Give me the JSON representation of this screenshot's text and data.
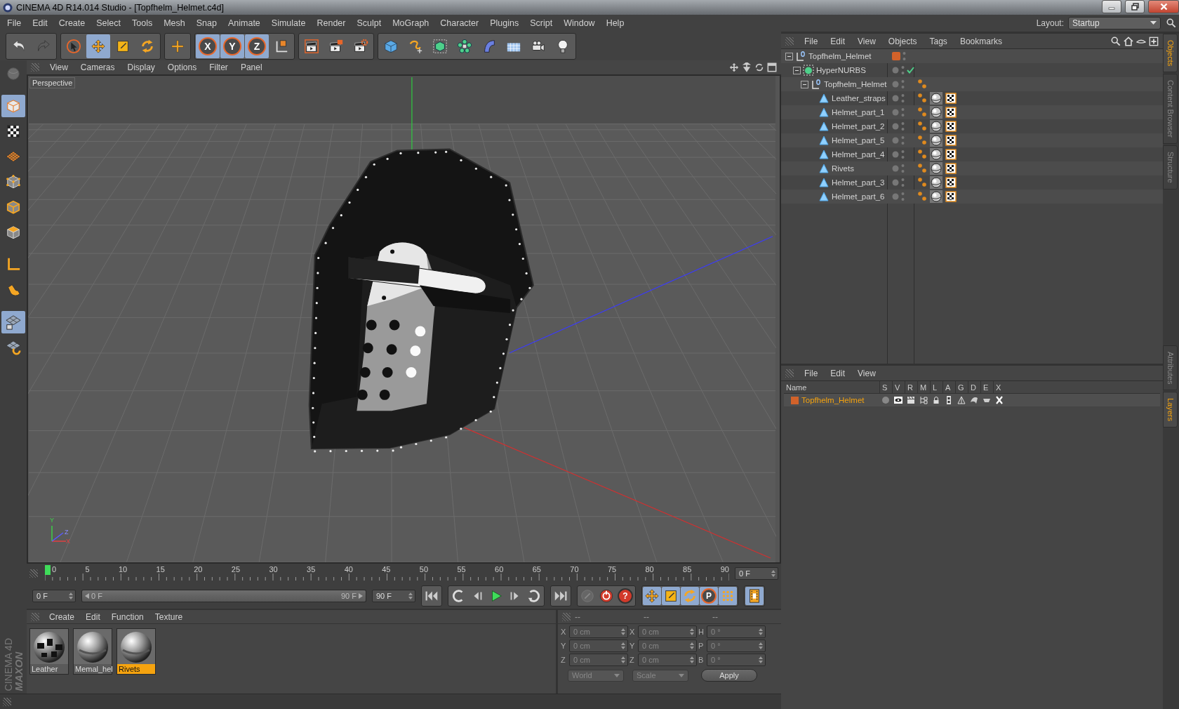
{
  "window": {
    "title": "CINEMA 4D R14.014 Studio - [Topfhelm_Helmet.c4d]"
  },
  "menu": [
    "File",
    "Edit",
    "Create",
    "Select",
    "Tools",
    "Mesh",
    "Snap",
    "Animate",
    "Simulate",
    "Render",
    "Sculpt",
    "MoGraph",
    "Character",
    "Plugins",
    "Script",
    "Window",
    "Help"
  ],
  "layout": {
    "label": "Layout:",
    "value": "Startup"
  },
  "toolbar": [
    {
      "buttons": [
        {
          "kind": "undo",
          "selected": false,
          "disabled": false
        },
        {
          "kind": "redo",
          "selected": false,
          "disabled": true
        }
      ]
    },
    {
      "buttons": [
        {
          "kind": "select",
          "selected": false,
          "disabled": false
        },
        {
          "kind": "move",
          "selected": true,
          "disabled": false
        },
        {
          "kind": "scale",
          "selected": false,
          "disabled": false
        },
        {
          "kind": "rotate",
          "selected": false,
          "disabled": false
        }
      ]
    },
    {
      "buttons": [
        {
          "kind": "add",
          "selected": false,
          "disabled": false
        }
      ]
    },
    {
      "buttons": [
        {
          "kind": "axis",
          "label": "X",
          "selected": true,
          "disabled": false
        },
        {
          "kind": "axis",
          "label": "Y",
          "selected": true,
          "disabled": false
        },
        {
          "kind": "axis",
          "label": "Z",
          "selected": true,
          "disabled": false
        },
        {
          "kind": "coords",
          "selected": false,
          "disabled": false
        }
      ]
    },
    {
      "buttons": [
        {
          "kind": "render-view",
          "selected": false,
          "disabled": false
        },
        {
          "kind": "render",
          "selected": false,
          "disabled": false
        },
        {
          "kind": "render-settings",
          "selected": false,
          "disabled": false
        }
      ]
    },
    {
      "buttons": [
        {
          "kind": "cube",
          "selected": false,
          "disabled": false
        },
        {
          "kind": "spline",
          "selected": false,
          "disabled": false
        },
        {
          "kind": "nurbs",
          "selected": false,
          "disabled": false
        },
        {
          "kind": "array",
          "selected": false,
          "disabled": false
        },
        {
          "kind": "deformer",
          "selected": false,
          "disabled": false
        },
        {
          "kind": "floor",
          "selected": false,
          "disabled": false
        },
        {
          "kind": "camera",
          "selected": false,
          "disabled": false
        },
        {
          "kind": "light",
          "selected": false,
          "disabled": false
        }
      ]
    }
  ],
  "tools": [
    {
      "kind": "make-editable",
      "selected": false
    },
    {
      "kind": "model",
      "selected": true
    },
    {
      "kind": "texture",
      "selected": false
    },
    {
      "kind": "workplane",
      "selected": false
    },
    {
      "kind": "points",
      "selected": false
    },
    {
      "kind": "edges",
      "selected": false
    },
    {
      "kind": "polygons",
      "selected": false
    },
    {
      "kind": "axis",
      "selected": false
    },
    {
      "kind": "magnet",
      "selected": false
    },
    {
      "kind": "snap-grid",
      "selected": true
    },
    {
      "kind": "snap",
      "selected": false
    }
  ],
  "brand": {
    "line_1": "MAXON",
    "line_2": "CINEMA 4D"
  },
  "viewport": {
    "menu": [
      "View",
      "Cameras",
      "Display",
      "Options",
      "Filter",
      "Panel"
    ],
    "camera": "Perspective",
    "axis_labels": {
      "y": "Y",
      "z": "Z",
      "x": "X"
    }
  },
  "timeline": {
    "ticks": [
      "0",
      "5",
      "10",
      "15",
      "20",
      "25",
      "30",
      "35",
      "40",
      "45",
      "50",
      "55",
      "60",
      "65",
      "70",
      "75",
      "80",
      "85",
      "90"
    ],
    "level": 0,
    "current": "0 F",
    "start": "0 F",
    "range": {
      "start": "0 F",
      "end": "90 F",
      "level": 1
    },
    "end": "90 F",
    "transport": [
      {
        "buttons": [
          {
            "kind": "first",
            "selected": false
          }
        ]
      },
      {
        "buttons": [
          {
            "kind": "prev-key",
            "selected": false
          },
          {
            "kind": "prev-frame",
            "selected": false
          },
          {
            "kind": "play",
            "selected": false
          },
          {
            "kind": "next-frame",
            "selected": false
          },
          {
            "kind": "next-key",
            "selected": false
          }
        ]
      },
      {
        "buttons": [
          {
            "kind": "last",
            "selected": false
          }
        ]
      },
      {
        "buttons": [
          {
            "kind": "autokey",
            "selected": false
          },
          {
            "kind": "record",
            "selected": false
          },
          {
            "kind": "help",
            "label": "?",
            "selected": false
          }
        ]
      },
      {
        "buttons": [
          {
            "kind": "move",
            "selected": true
          },
          {
            "kind": "scale",
            "selected": true
          },
          {
            "kind": "rotate",
            "selected": true
          },
          {
            "kind": "param",
            "label": "P",
            "selected": true
          },
          {
            "kind": "points-grid",
            "selected": true
          }
        ]
      },
      {
        "buttons": [
          {
            "kind": "film",
            "selected": true
          }
        ]
      }
    ]
  },
  "materials": {
    "menu": [
      "Create",
      "Edit",
      "Function",
      "Texture"
    ],
    "items": [
      {
        "name": "Leather",
        "selected": false
      },
      {
        "name": "Memal_hel",
        "selected": false
      },
      {
        "name": "Rivets",
        "selected": true
      }
    ]
  },
  "coordinates": {
    "headers": [
      "--",
      "--",
      "--"
    ],
    "rows": [
      {
        "position_axis": "X",
        "position": "0 cm",
        "size_axis": "X",
        "size": "0 cm",
        "rotation_axis": "H",
        "rotation": "0 °"
      },
      {
        "position_axis": "Y",
        "position": "0 cm",
        "size_axis": "Y",
        "size": "0 cm",
        "rotation_axis": "P",
        "rotation": "0 °"
      },
      {
        "position_axis": "Z",
        "position": "0 cm",
        "size_axis": "Z",
        "size": "0 cm",
        "rotation_axis": "B",
        "rotation": "0 °"
      }
    ],
    "space": "World",
    "mode": "Scale",
    "apply": "Apply"
  },
  "objects": {
    "menu": [
      "File",
      "Edit",
      "View",
      "Objects",
      "Tags",
      "Bookmarks"
    ],
    "tree": [
      {
        "name": "Topfhelm_Helmet",
        "kind": "null",
        "color": "#d2622a",
        "expanded": true,
        "children": [
          {
            "name": "HyperNURBS",
            "kind": "nurbs",
            "enabled": true,
            "expanded": true,
            "children": [
              {
                "name": "Topfhelm_Helmet",
                "kind": "null",
                "tags": [
                  {
                    "kind": "phong"
                  }
                ],
                "expanded": true,
                "children": [
                  {
                    "name": "Leather_straps",
                    "kind": "polygon",
                    "tags": [
                      {
                        "kind": "phong"
                      },
                      {
                        "kind": "material"
                      },
                      {
                        "kind": "uvw"
                      }
                    ]
                  },
                  {
                    "name": "Helmet_part_1",
                    "kind": "polygon",
                    "tags": [
                      {
                        "kind": "phong"
                      },
                      {
                        "kind": "material"
                      },
                      {
                        "kind": "uvw"
                      }
                    ]
                  },
                  {
                    "name": "Helmet_part_2",
                    "kind": "polygon",
                    "tags": [
                      {
                        "kind": "phong"
                      },
                      {
                        "kind": "material"
                      },
                      {
                        "kind": "uvw"
                      }
                    ]
                  },
                  {
                    "name": "Helmet_part_5",
                    "kind": "polygon",
                    "tags": [
                      {
                        "kind": "phong"
                      },
                      {
                        "kind": "material"
                      },
                      {
                        "kind": "uvw"
                      }
                    ]
                  },
                  {
                    "name": "Helmet_part_4",
                    "kind": "polygon",
                    "tags": [
                      {
                        "kind": "phong"
                      },
                      {
                        "kind": "material"
                      },
                      {
                        "kind": "uvw"
                      }
                    ]
                  },
                  {
                    "name": "Rivets",
                    "kind": "polygon",
                    "tags": [
                      {
                        "kind": "phong"
                      },
                      {
                        "kind": "material"
                      },
                      {
                        "kind": "uvw"
                      }
                    ]
                  },
                  {
                    "name": "Helmet_part_3",
                    "kind": "polygon",
                    "tags": [
                      {
                        "kind": "phong"
                      },
                      {
                        "kind": "material"
                      },
                      {
                        "kind": "uvw"
                      }
                    ]
                  },
                  {
                    "name": "Helmet_part_6",
                    "kind": "polygon",
                    "tags": [
                      {
                        "kind": "phong"
                      },
                      {
                        "kind": "material"
                      },
                      {
                        "kind": "uvw"
                      }
                    ]
                  }
                ]
              }
            ]
          }
        ]
      }
    ]
  },
  "layers": {
    "menu": [
      "File",
      "Edit",
      "View"
    ],
    "columns": [
      "Name",
      "S",
      "V",
      "R",
      "M",
      "L",
      "A",
      "G",
      "D",
      "E",
      "X"
    ],
    "rows": [
      {
        "name": "Topfhelm_Helmet",
        "color": "#d2622a",
        "selected": true
      }
    ]
  },
  "side_tabs_top": [
    {
      "label": "Objects",
      "selected": true
    },
    {
      "label": "Content Browser",
      "selected": false
    },
    {
      "label": "Structure",
      "selected": false
    }
  ],
  "side_tabs_bottom": [
    {
      "label": "Attributes",
      "selected": false
    },
    {
      "label": "Layers",
      "selected": true
    }
  ]
}
